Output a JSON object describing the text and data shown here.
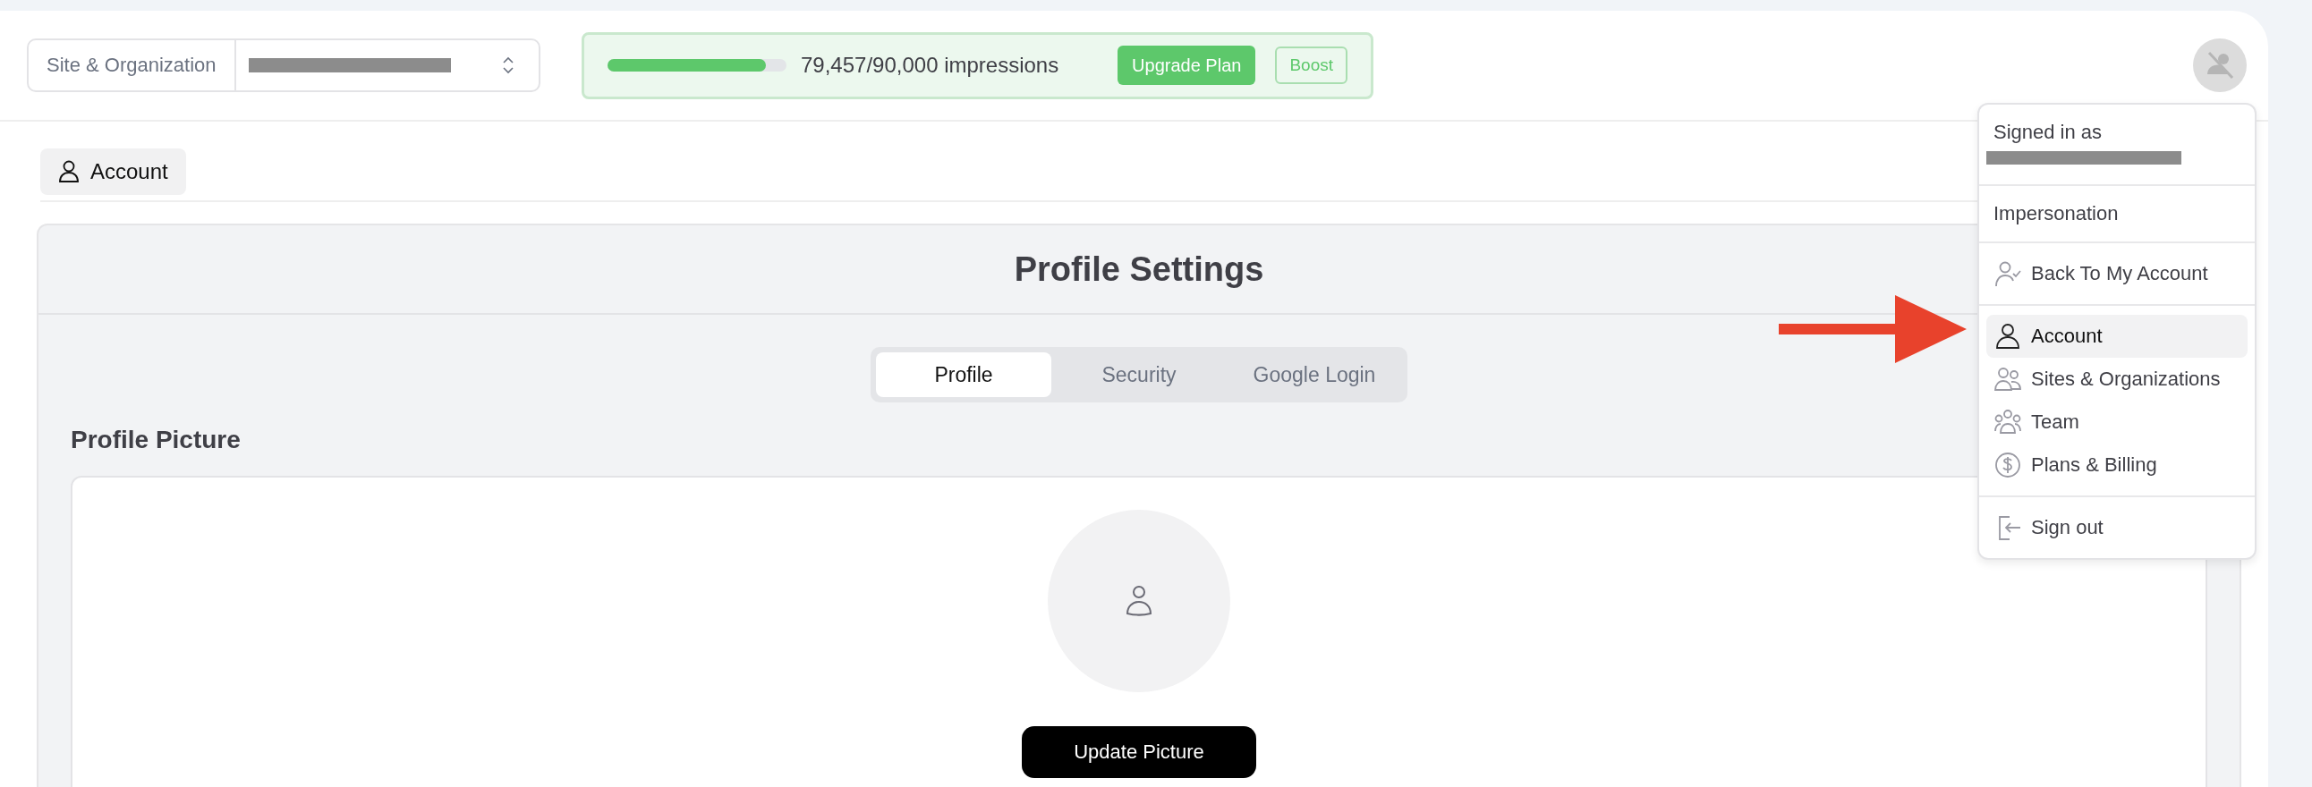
{
  "topbar": {
    "site_selector": {
      "label": "Site & Organization",
      "value_redacted": true
    },
    "usage": {
      "level": 0.883,
      "reading": "79,457/90,000 impressions",
      "upgrade_button": "Upgrade Plan",
      "boost_button": "Boost"
    }
  },
  "breadcrumb": {
    "label": "Account"
  },
  "profile_settings": {
    "title": "Profile Settings",
    "tabs": [
      {
        "label": "Profile",
        "selected": true
      },
      {
        "label": "Security",
        "selected": false
      },
      {
        "label": "Google Login",
        "selected": false
      }
    ],
    "section_title": "Profile Picture",
    "update_button": "Update Picture"
  },
  "user_menu": {
    "signed_in_label": "Signed in as",
    "email_redacted": true,
    "section_label": "Impersonation",
    "back_item": "Back To My Account",
    "items": [
      {
        "label": "Account",
        "selected": true
      },
      {
        "label": "Sites & Organizations",
        "selected": false
      },
      {
        "label": "Team",
        "selected": false
      },
      {
        "label": "Plans & Billing",
        "selected": false
      }
    ],
    "sign_out": "Sign out"
  }
}
